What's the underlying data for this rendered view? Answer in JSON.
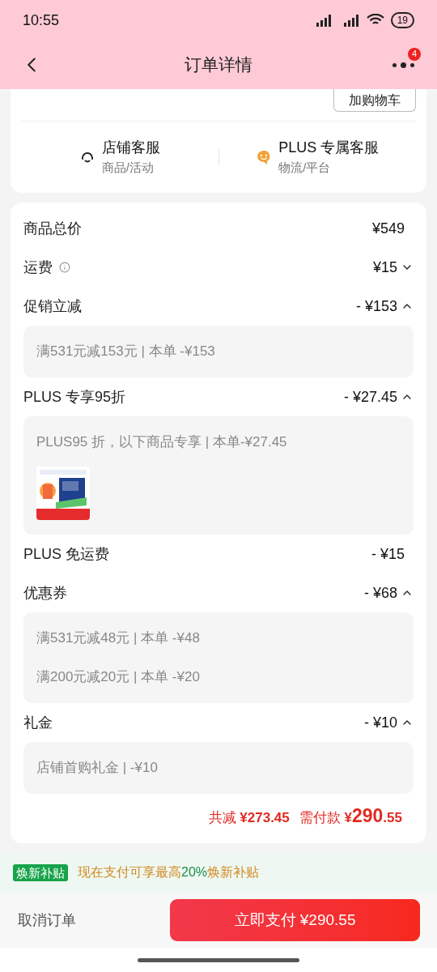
{
  "status_bar": {
    "time": "10:55",
    "battery": "19"
  },
  "nav": {
    "title": "订单详情",
    "badge": "4"
  },
  "top_card": {
    "cart_button": "加购物车",
    "services": [
      {
        "kind": "headset",
        "title": "店铺客服",
        "subtitle": "商品/活动"
      },
      {
        "kind": "smile",
        "title": "PLUS 专属客服",
        "subtitle": "物流/平台"
      }
    ]
  },
  "price_rows": [
    {
      "label": "商品总价",
      "amount": "¥549"
    },
    {
      "label": "运费",
      "info": true,
      "amount": "¥15",
      "expanded": false
    },
    {
      "label": "促销立减",
      "amount": "- ¥153",
      "expanded": true,
      "details": [
        {
          "kind": "text",
          "text": "满531元减153元 | 本单 -¥153"
        }
      ]
    },
    {
      "label": "PLUS 专享95折",
      "amount": "- ¥27.45",
      "expanded": true,
      "details": [
        {
          "kind": "text",
          "text": "PLUS95 折，以下商品专享 | 本单-¥27.45"
        },
        {
          "kind": "picture"
        }
      ]
    },
    {
      "label": "PLUS 免运费",
      "amount": "- ¥15"
    },
    {
      "label": "优惠券",
      "amount": "- ¥68",
      "expanded": true,
      "details": [
        {
          "kind": "text",
          "text": "满531元减48元 | 本单 -¥48"
        },
        {
          "kind": "text",
          "text": "满200元减20元 | 本单 -¥20"
        }
      ]
    },
    {
      "label": "礼金",
      "amount": "- ¥10",
      "expanded": true,
      "details": [
        {
          "kind": "text",
          "text": "店铺首购礼金 | -¥10"
        }
      ]
    }
  ],
  "summary": {
    "saved_label": "共减",
    "saved_amount": "¥273.45",
    "pay_label": "需付款",
    "pay_currency": "¥",
    "pay_integer": "290",
    "pay_decimal": ".55"
  },
  "banner": {
    "tag": "焕新补贴",
    "segments": [
      {
        "text": "现在支付可享最高",
        "highlight": false
      },
      {
        "text": "20%",
        "highlight": true
      },
      {
        "text": "焕新补贴",
        "highlight": false
      }
    ]
  },
  "bottom_bar": {
    "cancel": "取消订单",
    "pay": "立即支付 ¥290.55"
  }
}
